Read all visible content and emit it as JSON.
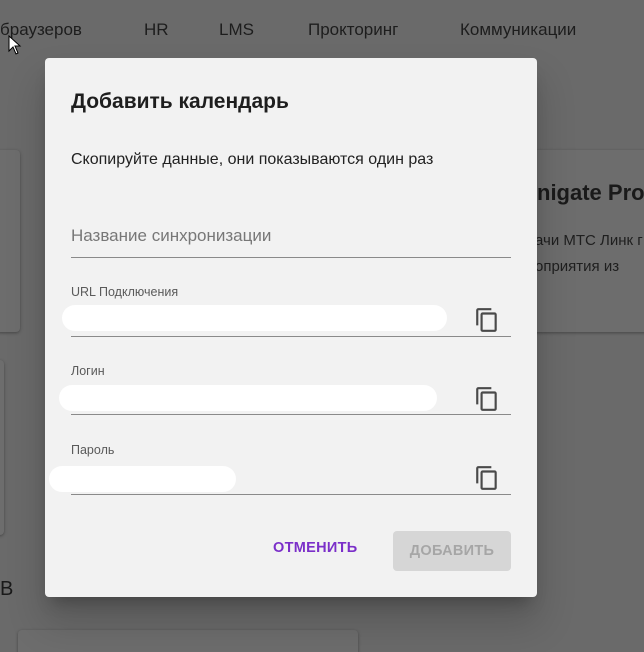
{
  "background": {
    "nav_items": [
      "браузеров",
      "HR",
      "LMS",
      "Прокторинг",
      "Коммуникации"
    ],
    "card_title": "nigate Pro",
    "card_text_line1": "ачи МТС Линк г",
    "card_text_line2": "оприятия из",
    "side_letter": "В"
  },
  "dialog": {
    "title": "Добавить календарь",
    "description": "Скопируйте данные, они показываются один раз",
    "sync_name_placeholder": "Название синхронизации",
    "url_label": "URL Подключения",
    "login_label": "Логин",
    "password_label": "Пароль",
    "cancel_label": "Отменить",
    "add_label": "Добавить"
  },
  "colors": {
    "accent": "#7b2fc9",
    "overlay": "#6a6a6a",
    "dialog_bg": "#f2f2f2",
    "disabled_button_bg": "#d6d6d6",
    "disabled_button_text": "#a6a6a6"
  },
  "icons": {
    "copy": "copy-icon",
    "cursor": "mouse-cursor-icon"
  }
}
